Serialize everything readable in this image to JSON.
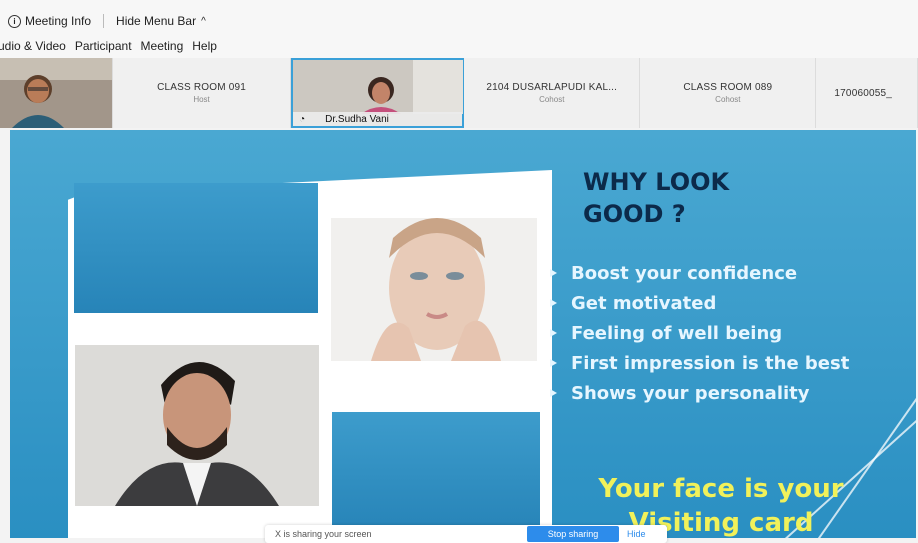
{
  "top": {
    "meeting_info": "Meeting Info",
    "hide_menu_bar": "Hide Menu Bar",
    "menu": [
      "udio & Video",
      "Participant",
      "Meeting",
      "Help"
    ]
  },
  "participants": [
    {
      "type": "video",
      "name": "",
      "role": ""
    },
    {
      "type": "text",
      "name": "CLASS ROOM 091",
      "role": "Host"
    },
    {
      "type": "video-active",
      "name": "Dr.Sudha Vani",
      "role": ""
    },
    {
      "type": "text",
      "name": "2104 DUSARLAPUDI KAL...",
      "role": "Cohost"
    },
    {
      "type": "text",
      "name": "CLASS ROOM 089",
      "role": "Cohost"
    },
    {
      "type": "text",
      "name": "170060055_",
      "role": ""
    }
  ],
  "slide": {
    "title_line1": "WHY LOOK",
    "title_line2": "GOOD ?",
    "bullets": [
      "Boost your confidence",
      "Get motivated",
      "Feeling of well being",
      "First impression is the best",
      "Shows  your personality"
    ],
    "bottom_line1": "Your face is your",
    "bottom_line2": "Visiting card"
  },
  "share_banner": {
    "text": "X  is sharing your screen",
    "stop_label": "Stop sharing",
    "hide_label": "Hide"
  },
  "colors": {
    "slide_bg": "#3a9dcc",
    "title": "#0c2a4a",
    "bullet": "#e6f6ff",
    "bottom_text": "#f1f15a",
    "active_border": "#3aa0d8"
  }
}
